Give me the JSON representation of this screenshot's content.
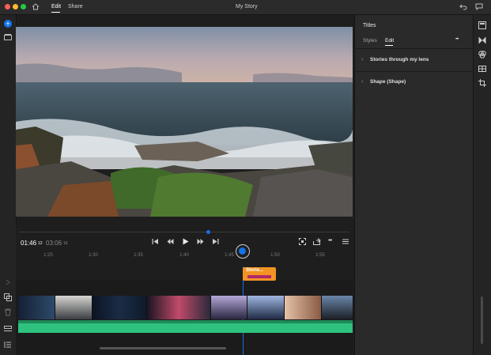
{
  "titlebar": {
    "tab_edit": "Edit",
    "tab_share": "Share",
    "title": "My Story"
  },
  "panel": {
    "heading": "Titles",
    "tab_styles": "Styles",
    "tab_edit": "Edit",
    "more": "•••",
    "section1": "Stories through my lens",
    "section2": "Shape (Shape)"
  },
  "player": {
    "current_time": "01:46",
    "current_frames": "12",
    "total_time": "03:06",
    "total_frames": "16",
    "ticks": [
      "1:25",
      "1:30",
      "1:35",
      "1:40",
      "1:45",
      "1:50",
      "1:55"
    ]
  },
  "timeline": {
    "title_clip": "Storie..."
  },
  "colors": {
    "accent": "#1473e6",
    "title_clip": "#f29423",
    "audio": "#2ec27e"
  },
  "icons": {
    "home": "home-icon",
    "add": "add-icon",
    "media": "media-icon",
    "undo": "undo-icon",
    "comment": "comment-icon"
  }
}
